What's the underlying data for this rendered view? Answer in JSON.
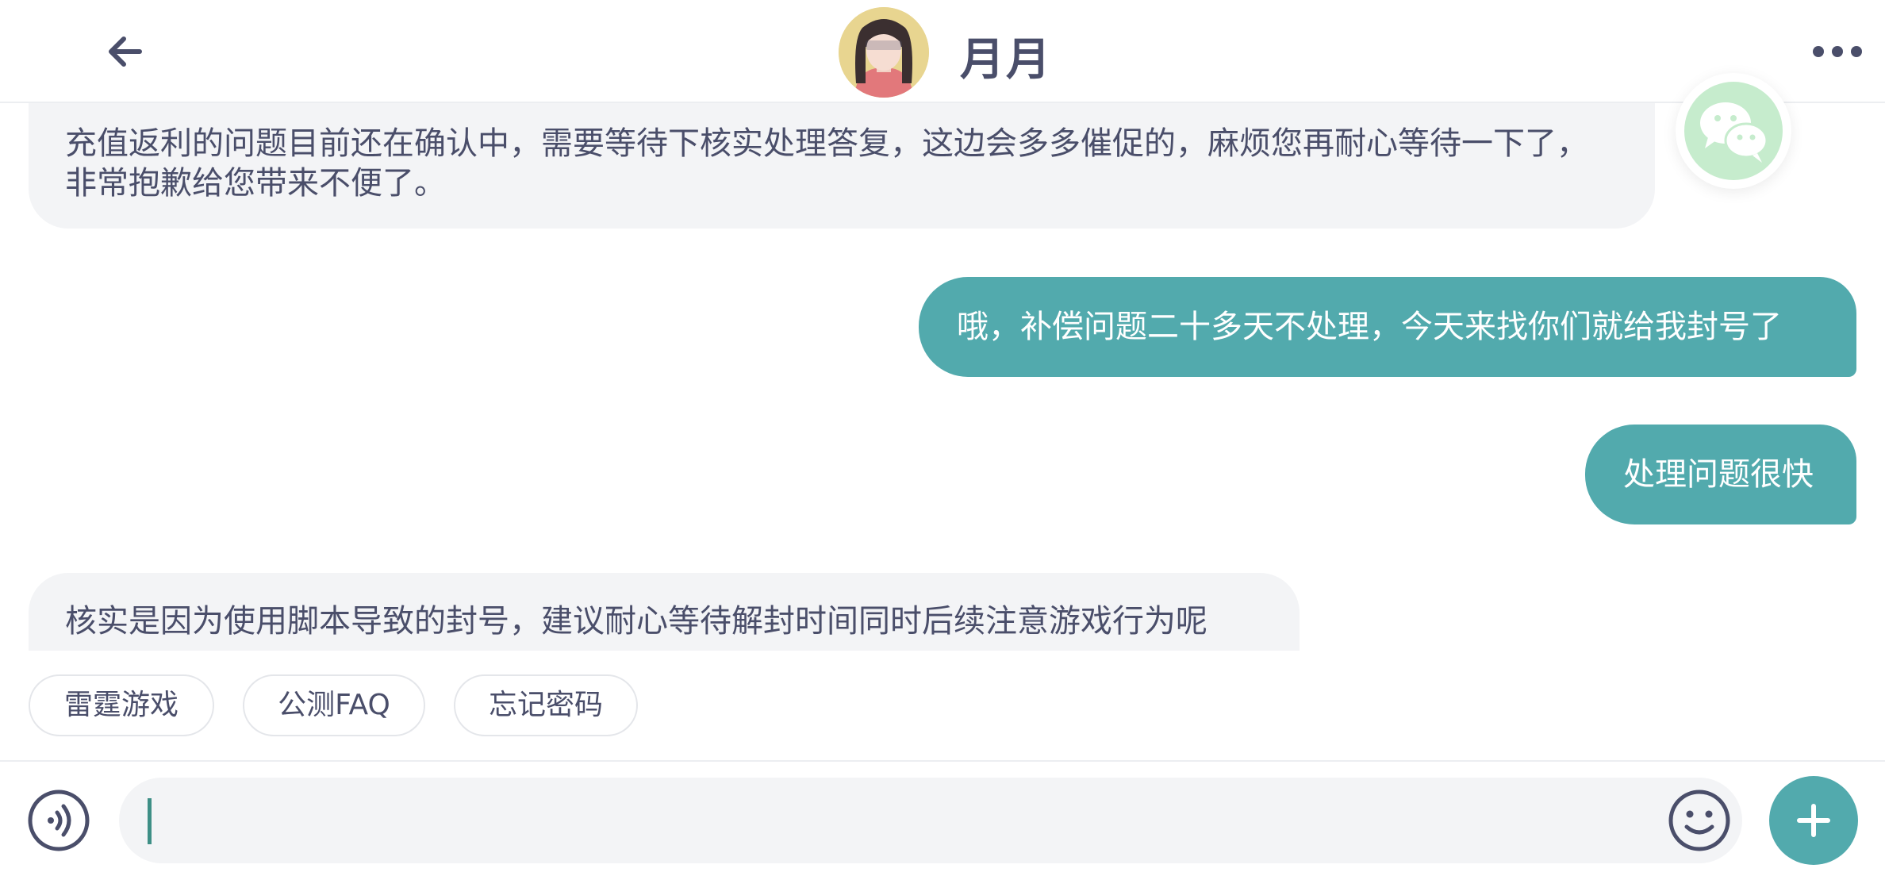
{
  "header": {
    "title": "月月",
    "back_icon": "arrow-left-icon",
    "more_icon": "more-horizontal-icon",
    "avatar": "customer-service-avatar"
  },
  "messages": [
    {
      "direction": "incoming",
      "text": "充值返利的问题目前还在确认中，需要等待下核实处理答复，这边会多多催促的，麻烦您再耐心等待一下了，非常抱歉给您带来不便了。"
    },
    {
      "direction": "outgoing",
      "text": "哦，补偿问题二十多天不处理，今天来找你们就给我封号了"
    },
    {
      "direction": "outgoing",
      "text": "处理问题很快"
    },
    {
      "direction": "incoming",
      "text": "核实是因为使用脚本导致的封号，建议耐心等待解封时间同时后续注意游戏行为呢"
    }
  ],
  "wechat_fab": {
    "icon": "wechat-icon"
  },
  "quick_replies": [
    "雷霆游戏",
    "公测FAQ",
    "忘记密码"
  ],
  "input": {
    "value": "",
    "placeholder": "",
    "voice_icon": "voice-icon",
    "emoji_icon": "emoji-icon",
    "plus_icon": "plus-icon"
  },
  "colors": {
    "accent": "#52aaad",
    "incoming_bubble": "#f3f4f6",
    "text": "#4a4e6a",
    "wechat_green": "#c6eccd"
  }
}
